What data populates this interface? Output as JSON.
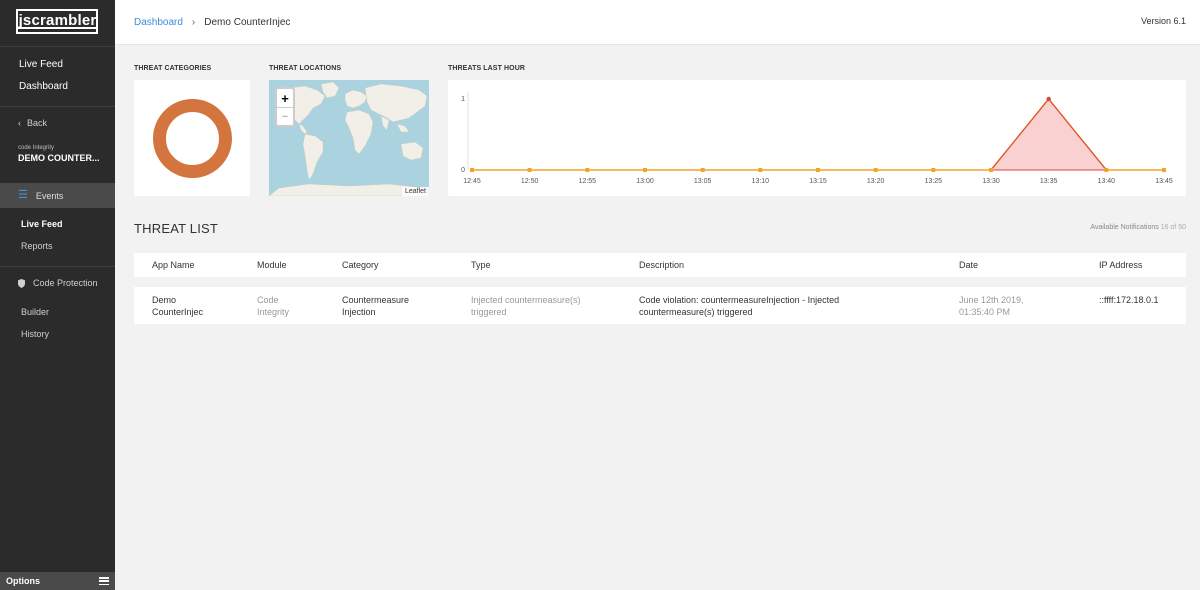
{
  "sidebar": {
    "logo": "jscrambler",
    "nav": [
      "Live Feed",
      "Dashboard"
    ],
    "back_label": "Back",
    "app_type": "code Integrity",
    "app_name": "DEMO COUNTER...",
    "events_label": "Events",
    "events_items": [
      "Live Feed",
      "Reports"
    ],
    "code_protection_label": "Code Protection",
    "code_protection_items": [
      "Builder",
      "History"
    ],
    "options_label": "Options"
  },
  "header": {
    "breadcrumb": [
      "Dashboard",
      "Demo CounterInjec"
    ],
    "version": "Version 6.1"
  },
  "widgets": {
    "categories_label": "THREAT CATEGORIES",
    "locations_label": "THREAT LOCATIONS",
    "last_hour_label": "THREATS LAST HOUR",
    "map_attribution": "Leaflet",
    "zoom_in": "+",
    "zoom_out": "−"
  },
  "colors": {
    "donut": "#d4743e",
    "line": "#f0a428",
    "area_fill": "#f9d1d1",
    "area_stroke": "#d94545",
    "accent": "#3b8ed6",
    "sidebar_bg": "#2b2b2b"
  },
  "chart_data": {
    "type": "line",
    "x": [
      "12:45",
      "12:50",
      "12:55",
      "13:00",
      "13:05",
      "13:10",
      "13:15",
      "13:20",
      "13:25",
      "13:30",
      "13:35",
      "13:40",
      "13:45"
    ],
    "series": [
      {
        "values": [
          0,
          0,
          0,
          0,
          0,
          0,
          0,
          0,
          0,
          0,
          1,
          0,
          0
        ]
      }
    ],
    "yticks": [
      "0",
      "1"
    ],
    "ylim": [
      0,
      1
    ],
    "grid": false
  },
  "threat_list": {
    "title": "THREAT LIST",
    "available_label": "Available Notifications",
    "available_count": "16 of 50",
    "columns": [
      "App Name",
      "Module",
      "Category",
      "Type",
      "Description",
      "Date",
      "IP Address"
    ],
    "rows": [
      {
        "app_name": [
          "Demo",
          "CounterInjec"
        ],
        "module": [
          "Code",
          "Integrity"
        ],
        "category": [
          "Countermeasure",
          "Injection"
        ],
        "type": [
          "Injected countermeasure(s)",
          "triggered"
        ],
        "description": [
          "Code violation: countermeasureInjection - Injected",
          "countermeasure(s) triggered"
        ],
        "date": [
          "June 12th 2019,",
          "01:35:40 PM"
        ],
        "ip": "::ffff:172.18.0.1"
      }
    ]
  }
}
